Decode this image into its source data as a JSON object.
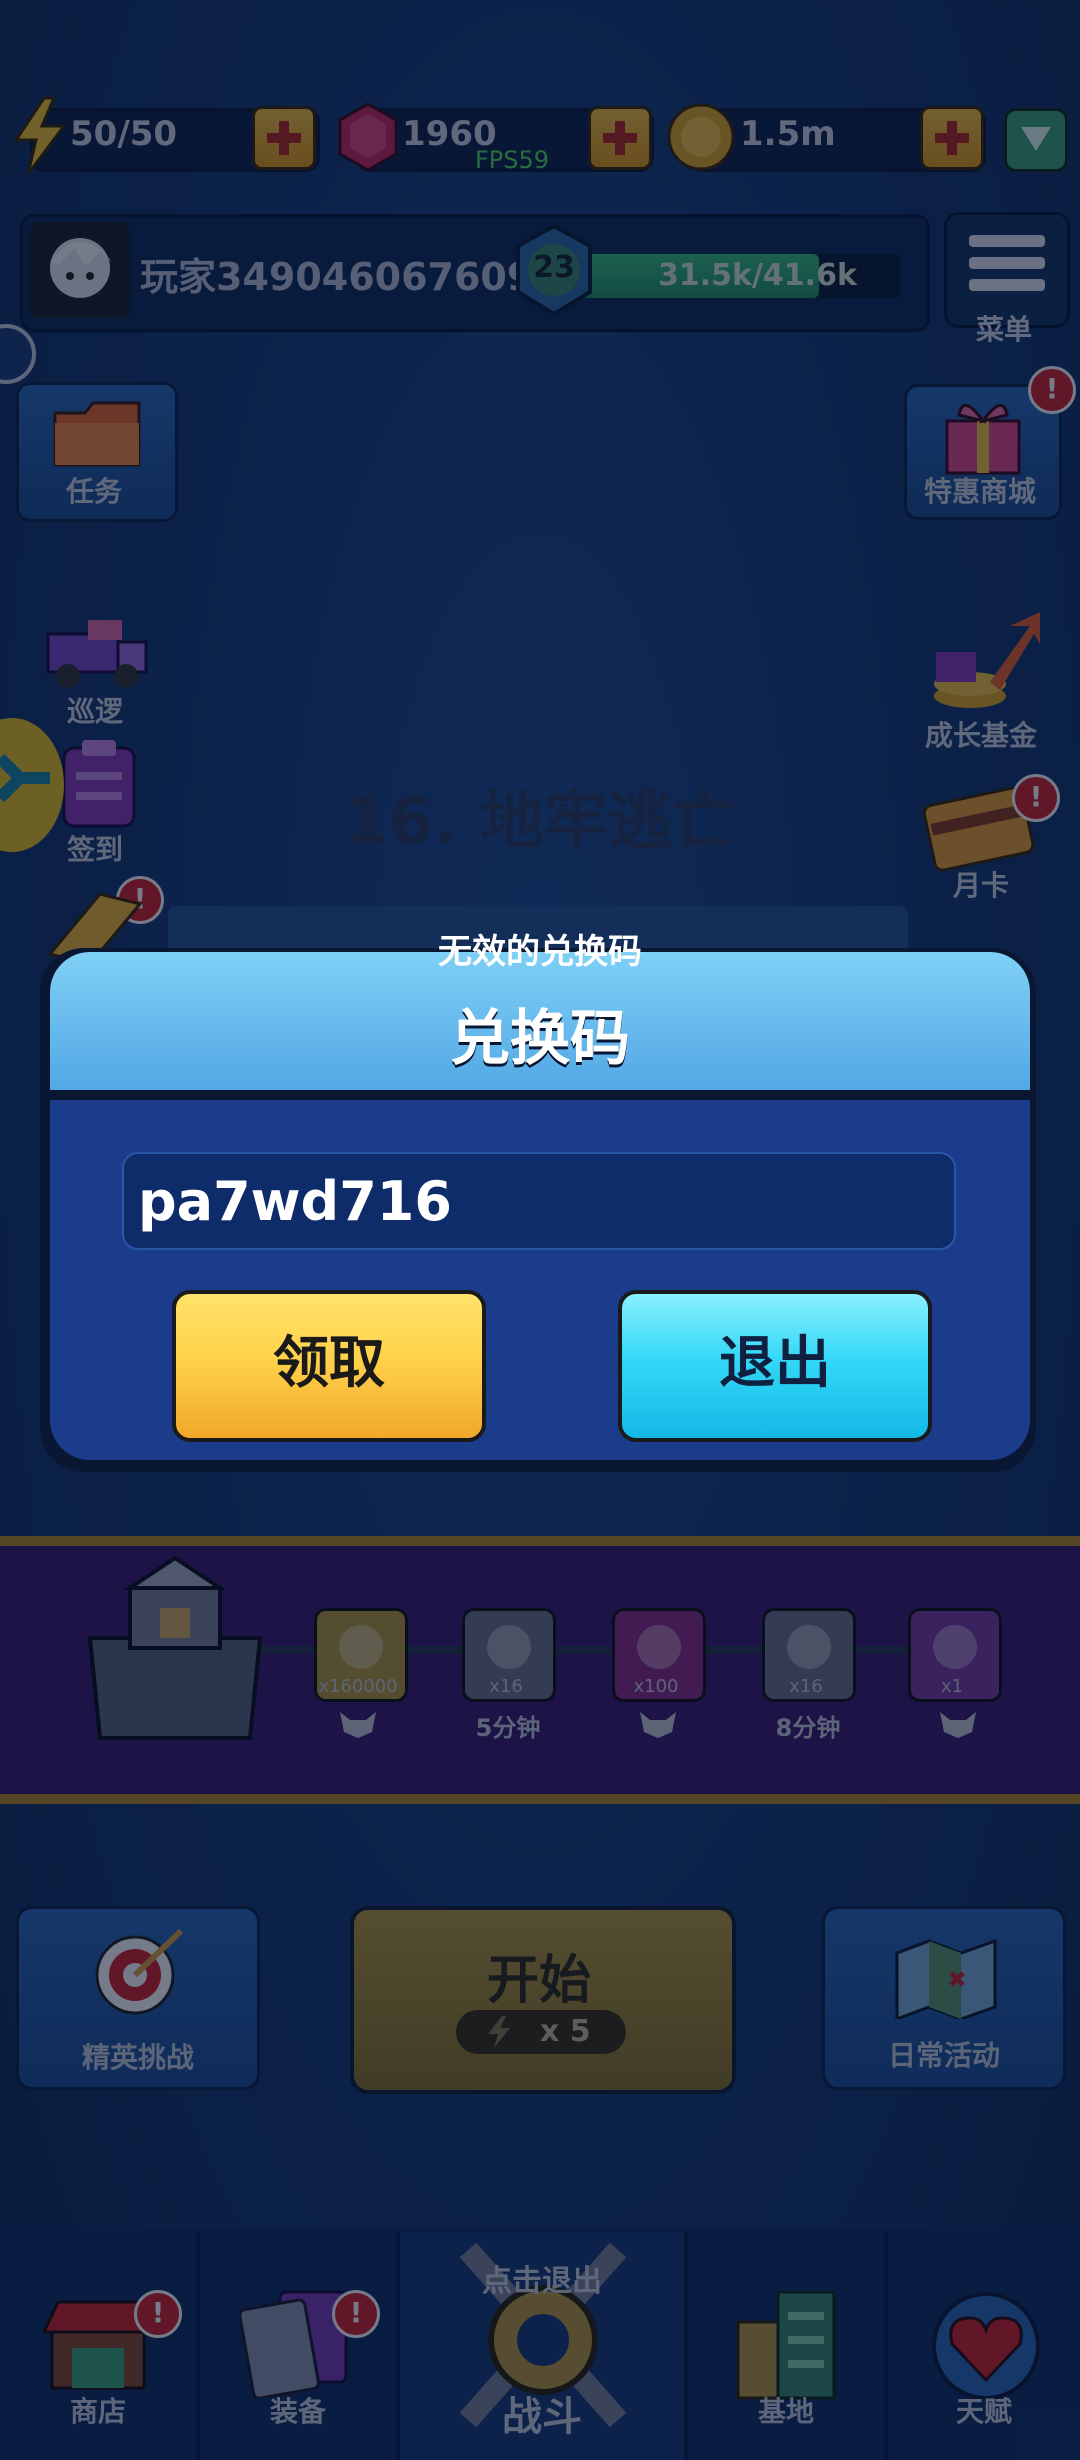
{
  "top_bar": {
    "energy": "50/50",
    "gems": "1960",
    "coins": "1.5m",
    "fps": "FPS59"
  },
  "profile": {
    "name": "玩家3490460676099",
    "level": "23",
    "xp": "31.5k/41.6k",
    "xp_fraction": 0.757,
    "menu_label": "菜单"
  },
  "side_left": {
    "tasks": "任务",
    "patrol": "巡逻",
    "checkin": "签到"
  },
  "side_right": {
    "shop_special": "特惠商城",
    "growth_fund": "成长基金",
    "monthly_card": "月卡"
  },
  "level_title": "16. 地牢逃亡",
  "toast": "无效的兑换码",
  "dialog": {
    "title": "兑换码",
    "code_value": "pa7wd716",
    "claim_label": "领取",
    "exit_label": "退出"
  },
  "rewards": {
    "items": [
      {
        "qty": "x160000",
        "icon": "coin-icon",
        "color": "#b59a3a"
      },
      {
        "qty": "x16",
        "icon": "mystery-ticket-icon",
        "color": "#6b7386"
      },
      {
        "qty": "x100",
        "icon": "gem-icon",
        "color": "#8a2a86"
      },
      {
        "qty": "x16",
        "icon": "capsule-icon",
        "color": "#6b7386"
      },
      {
        "qty": "x1",
        "icon": "key-icon",
        "color": "#7a3aa0"
      }
    ],
    "time_1": "5分钟",
    "time_2": "8分钟"
  },
  "actions": {
    "elite_challenge": "精英挑战",
    "start": "开始",
    "energy_cost": "x 5",
    "daily_events": "日常活动"
  },
  "nav": {
    "shop": "商店",
    "equipment": "装备",
    "battle": "战斗",
    "battle_hint": "点击退出",
    "base": "基地",
    "talent": "天赋"
  },
  "colors": {
    "claim_button": "#ffd24a",
    "exit_button": "#33d8f7",
    "dialog_header": "#6cc0f0",
    "dialog_body": "#1a3c8b"
  }
}
